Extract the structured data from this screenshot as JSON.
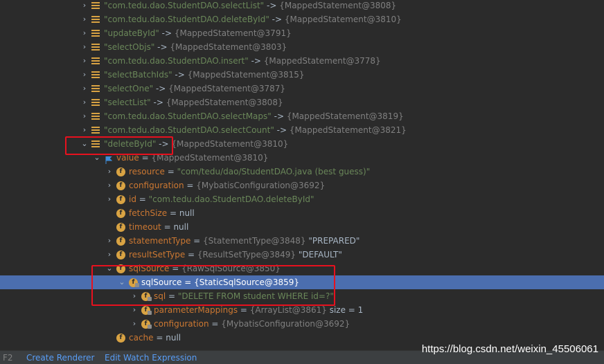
{
  "rows": [
    {
      "depth": 0,
      "arrow": "›",
      "icon": "list",
      "key": "\"com.tedu.dao.StudentDAO.selectList\"",
      "sep": " -> ",
      "value": "{MappedStatement@3808}"
    },
    {
      "depth": 0,
      "arrow": "›",
      "icon": "list",
      "key": "\"com.tedu.dao.StudentDAO.deleteById\"",
      "sep": " -> ",
      "value": "{MappedStatement@3810}"
    },
    {
      "depth": 0,
      "arrow": "›",
      "icon": "list",
      "key": "\"updateById\"",
      "sep": " -> ",
      "value": "{MappedStatement@3791}"
    },
    {
      "depth": 0,
      "arrow": "›",
      "icon": "list",
      "key": "\"selectObjs\"",
      "sep": " -> ",
      "value": "{MappedStatement@3803}"
    },
    {
      "depth": 0,
      "arrow": "›",
      "icon": "list",
      "key": "\"com.tedu.dao.StudentDAO.insert\"",
      "sep": " -> ",
      "value": "{MappedStatement@3778}"
    },
    {
      "depth": 0,
      "arrow": "›",
      "icon": "list",
      "key": "\"selectBatchIds\"",
      "sep": " -> ",
      "value": "{MappedStatement@3815}"
    },
    {
      "depth": 0,
      "arrow": "›",
      "icon": "list",
      "key": "\"selectOne\"",
      "sep": " -> ",
      "value": "{MappedStatement@3787}"
    },
    {
      "depth": 0,
      "arrow": "›",
      "icon": "list",
      "key": "\"selectList\"",
      "sep": " -> ",
      "value": "{MappedStatement@3808}"
    },
    {
      "depth": 0,
      "arrow": "›",
      "icon": "list",
      "key": "\"com.tedu.dao.StudentDAO.selectMaps\"",
      "sep": " -> ",
      "value": "{MappedStatement@3819}"
    },
    {
      "depth": 0,
      "arrow": "›",
      "icon": "list",
      "key": "\"com.tedu.dao.StudentDAO.selectCount\"",
      "sep": " -> ",
      "value": "{MappedStatement@3821}"
    },
    {
      "depth": 0,
      "arrow": "⌄",
      "icon": "list",
      "key": "\"deleteById\"",
      "sep": " -> ",
      "value": "{MappedStatement@3810}"
    },
    {
      "depth": 1,
      "arrow": "⌄",
      "icon": "flag",
      "key": "value",
      "sep": " = ",
      "value": "{MappedStatement@3810}"
    },
    {
      "depth": 2,
      "arrow": "›",
      "icon": "field",
      "key": "resource",
      "sep": " = ",
      "value": "\"com/tedu/dao/StudentDAO.java (best guess)\"",
      "vclass": "str"
    },
    {
      "depth": 2,
      "arrow": "›",
      "icon": "field",
      "key": "configuration",
      "sep": " = ",
      "value": "{MybatisConfiguration@3692}"
    },
    {
      "depth": 2,
      "arrow": "›",
      "icon": "field",
      "key": "id",
      "sep": " = ",
      "value": "\"com.tedu.dao.StudentDAO.deleteById\"",
      "vclass": "str"
    },
    {
      "depth": 2,
      "arrow": "",
      "icon": "field",
      "key": "fetchSize",
      "sep": " = ",
      "value": "null",
      "vclass": "val"
    },
    {
      "depth": 2,
      "arrow": "",
      "icon": "field",
      "key": "timeout",
      "sep": " = ",
      "value": "null",
      "vclass": "val"
    },
    {
      "depth": 2,
      "arrow": "›",
      "icon": "field",
      "key": "statementType",
      "sep": " = ",
      "value": "{StatementType@3848}",
      "extra": " \"PREPARED\""
    },
    {
      "depth": 2,
      "arrow": "›",
      "icon": "field",
      "key": "resultSetType",
      "sep": " = ",
      "value": "{ResultSetType@3849}",
      "extra": " \"DEFAULT\""
    },
    {
      "depth": 2,
      "arrow": "⌄",
      "icon": "field",
      "key": "sqlSource",
      "sep": " = ",
      "value": "{RawSqlSource@3850}"
    },
    {
      "depth": 3,
      "arrow": "⌄",
      "icon": "field",
      "lock": true,
      "key": "sqlSource",
      "sep": " = ",
      "value": "{StaticSqlSource@3859}",
      "selected": true
    },
    {
      "depth": 4,
      "arrow": "›",
      "icon": "field",
      "lock": true,
      "key": "sql",
      "sep": " = ",
      "value": "\"DELETE FROM student WHERE id=?\"",
      "vclass": "str"
    },
    {
      "depth": 4,
      "arrow": "›",
      "icon": "field",
      "lock": true,
      "key": "parameterMappings",
      "sep": " = ",
      "value": "{ArrayList@3861}",
      "extra": "  size = 1"
    },
    {
      "depth": 4,
      "arrow": "›",
      "icon": "field",
      "lock": true,
      "key": "configuration",
      "sep": " = ",
      "value": "{MybatisConfiguration@3692}"
    },
    {
      "depth": 2,
      "arrow": "",
      "icon": "field",
      "key": "cache",
      "sep": " = ",
      "value": "null",
      "vclass": "val"
    }
  ],
  "statusbar": {
    "key": "F2",
    "create_renderer": "Create Renderer",
    "edit_watch": "Edit Watch Expression"
  },
  "watermark": "https://blog.csdn.net/weixin_45506061",
  "colors": {
    "background": "#2b2b2b",
    "selection": "#4b6eaf",
    "highlight_box": "#e8111e",
    "string": "#6a8759",
    "reference": "#808080"
  }
}
